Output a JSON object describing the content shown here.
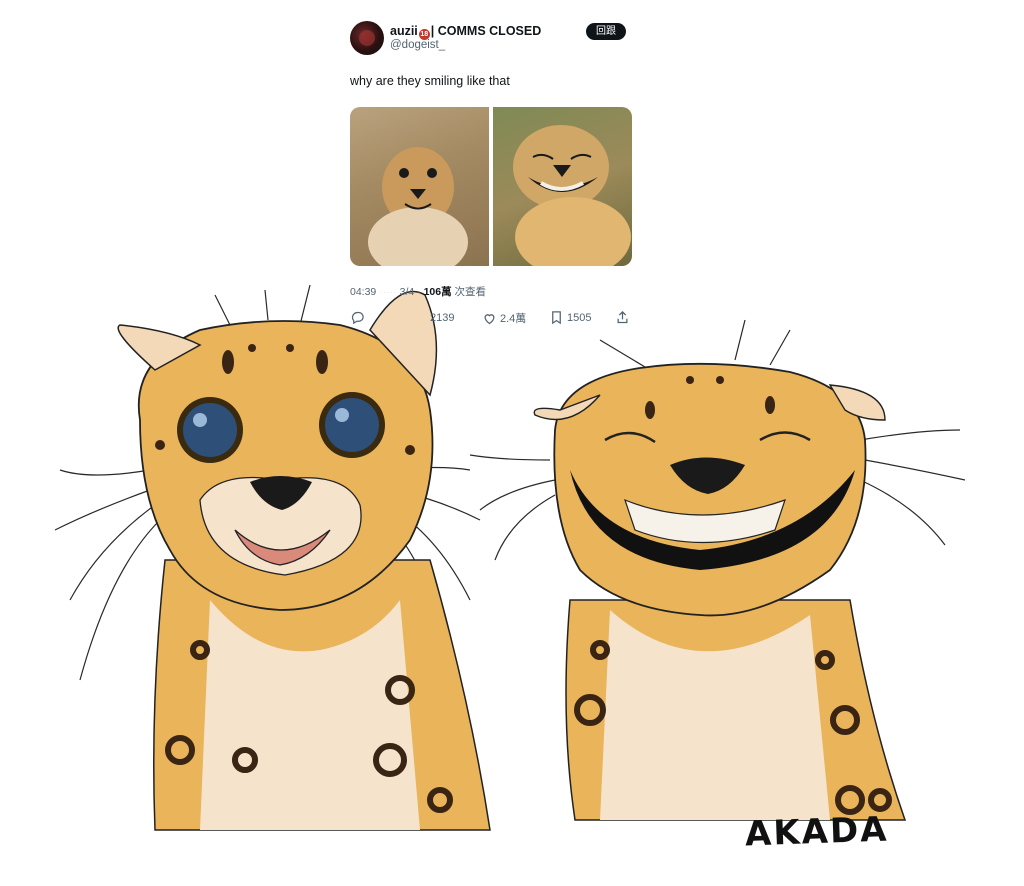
{
  "tweet": {
    "display_name": "auzii",
    "badge": "18",
    "name_suffix": "| COMMS CLOSED",
    "handle": "@dogeist_",
    "reply_button": "回跟",
    "text": "why are they smiling like that",
    "time": "04:39",
    "date": "3/4",
    "views_count": "106萬",
    "views_label": "次查看",
    "actions": {
      "comments": "",
      "retweets": "2139",
      "likes": "2.4萬",
      "bookmarks": "1505"
    },
    "icons": [
      "reply-icon",
      "retweet-icon",
      "heart-icon",
      "bookmark-icon",
      "share-icon"
    ]
  },
  "artwork": {
    "signature": "AKADA",
    "description_colors": {
      "fur": "#e9b45a",
      "belly": "#f6e3cc",
      "spots": "#3a2414",
      "eyes": "#2e4f78"
    }
  }
}
